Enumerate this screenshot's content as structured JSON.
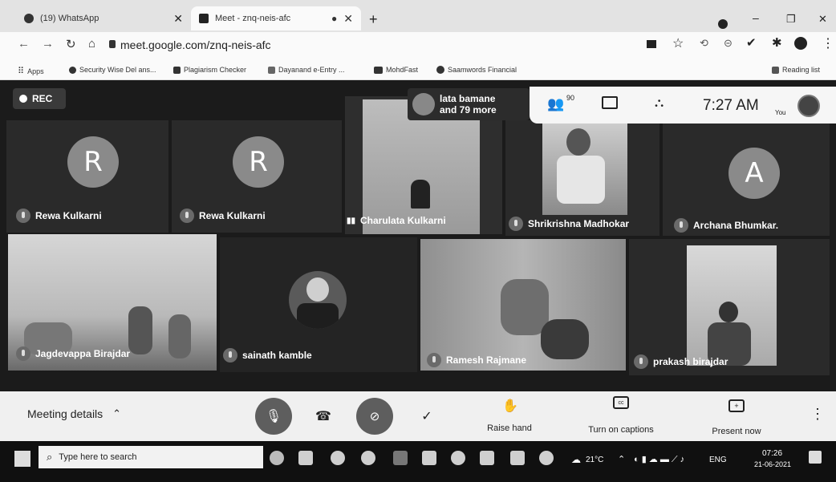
{
  "browser": {
    "tabs": [
      {
        "title": "(19) WhatsApp"
      },
      {
        "title": "Meet - znq-neis-afc"
      }
    ],
    "url": "meet.google.com/znq-neis-afc",
    "bookmarks": [
      "Apps",
      "Security Wise Del ans...",
      "Plagiarism Checker",
      "Dayanand e-Entry ...",
      "MohdFast",
      "Saamwords Financial"
    ],
    "reading_list": "Reading list"
  },
  "meet": {
    "rec_label": "REC",
    "others_line1": "lata bamane",
    "others_line2": "and 79 more",
    "participant_count": "90",
    "clock": "7:27 AM",
    "you_label": "You",
    "participants": [
      {
        "name": "Rewa Kulkarni",
        "initial": "R"
      },
      {
        "name": "Rewa Kulkarni",
        "initial": "R"
      },
      {
        "name": "Charulata Kulkarni",
        "initial": ""
      },
      {
        "name": "Shrikrishna Madhokar",
        "initial": ""
      },
      {
        "name": "Archana Bhumkar.",
        "initial": "A"
      },
      {
        "name": "Jagdevappa Birajdar",
        "initial": ""
      },
      {
        "name": "sainath kamble",
        "initial": ""
      },
      {
        "name": "Ramesh Rajmane",
        "initial": ""
      },
      {
        "name": "prakash birajdar",
        "initial": ""
      }
    ]
  },
  "controls": {
    "meeting_details": "Meeting details",
    "raise_hand": "Raise hand",
    "captions": "Turn on captions",
    "present": "Present now"
  },
  "taskbar": {
    "search_placeholder": "Type here to search",
    "weather": "21°C",
    "lang": "ENG",
    "time": "07:26",
    "date": "21-06-2021"
  }
}
